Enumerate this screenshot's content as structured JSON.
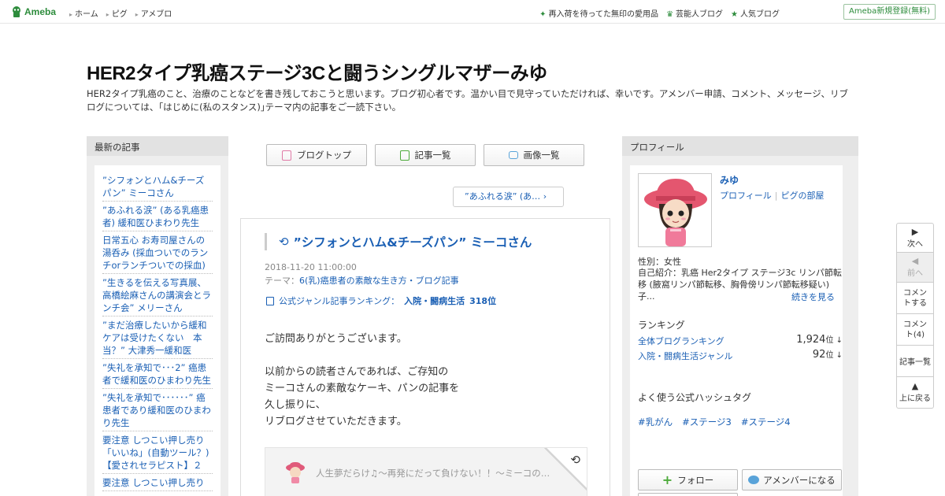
{
  "topbar": {
    "logo_text": "Ameba",
    "nav": [
      "ホーム",
      "ピグ",
      "アメブロ"
    ],
    "links": [
      {
        "icon": "sparkle-icon",
        "label": "再入荷を待ってた無印の愛用品"
      },
      {
        "icon": "crown-icon",
        "label": "芸能人ブログ"
      },
      {
        "icon": "star-icon",
        "label": "人気ブログ"
      }
    ],
    "register_label": "Ameba新規登録(無料)"
  },
  "blog": {
    "title": "HER2タイプ乳癌ステージ3Cと闘うシングルマザーみゆ",
    "description": "HER2タイプ乳癌のこと、治療のことなどを書き残しておこうと思います。ブログ初心者です。温かい目で見守っていただければ、幸いです。アメンバー申請、コメント、メッセージ、リブログについては、｢はじめに(私のスタンス)｣テーマ内の記事をご一読下さい。"
  },
  "left_sidebar": {
    "heading": "最新の記事",
    "items": [
      "”シフォンとハム&チーズパン” ミーコさん",
      "”あふれる涙” (ある乳癌患者) 緩和医ひまわり先生",
      "日常五心 お寿司屋さんの湯呑み (採血ついでのランチorランチついでの採血)",
      "”生きるを伝える写真展、高橋絵麻さんの講演会とランチ会” メリーさん",
      "”まだ治療したいから緩和ケアは受けたくない　本当？” 大津秀一緩和医",
      "”失礼を承知で･･･2” 癌患者で緩和医のひまわり先生",
      "”失礼を承知で･･････” 癌患者であり緩和医のひまわり先生",
      "要注意 しつこい押し売り「いいね」(自動ツール？)【愛されセラピスト】２",
      "要注意 しつこい押し売り"
    ]
  },
  "center": {
    "nav_buttons": [
      "ブログトップ",
      "記事一覧",
      "画像一覧"
    ],
    "prev_entry_label": "”あふれる涙” (あ…",
    "article": {
      "title": "”シフォンとハム&チーズパン” ミーコさん",
      "date": "2018-11-20 11:00:00",
      "theme_prefix": "テーマ：",
      "theme": "6(乳)癌患者の素敵な生き方・ブログ記事",
      "rank_prefix": "公式ジャンル記事ランキング：",
      "rank_category": "入院・闘病生活",
      "rank_value": "318位",
      "body": [
        "ご訪問ありがとうございます。",
        "以前からの読者さんであれば、ご存知の\nミーコさんの素敵なケーキ、パンの記事を\n久し振りに、\nリブログさせていただきます。"
      ],
      "reblog_text": "人生夢だらけ♫〜再発にだって負けない！！〜ミーコの…"
    }
  },
  "right_sidebar": {
    "heading": "プロフィール",
    "name": "みゆ",
    "links": [
      "プロフィール",
      "ピグの部屋"
    ],
    "gender": "性別：女性",
    "intro": "自己紹介：乳癌 Her2タイプ ステージ3c リンパ節転移 (腋窩リンパ節転移、胸骨傍リンパ節転移疑い) 子...",
    "more_label": "続きを見る",
    "ranking_heading": "ランキング",
    "rankings": [
      {
        "label": "全体ブログランキング",
        "value": "1,924",
        "unit": "位 ↓"
      },
      {
        "label": "入院・闘病生活ジャンル",
        "value": "92",
        "unit": "位 ↓"
      }
    ],
    "hashtag_heading": "よく使う公式ハッシュタグ",
    "hashtags": [
      "#乳がん",
      "#ステージ3",
      "#ステージ4"
    ],
    "follow_label": "フォロー",
    "amember_label": "アメンバーになる"
  },
  "float_nav": {
    "next": "次へ",
    "prev": "前へ",
    "comment": "コメントする",
    "comment_count": "コメント(4)",
    "list": "記事一覧",
    "top": "上に戻る"
  },
  "colors": {
    "accent_green": "#2d8c3c",
    "link_blue": "#1a5fb4",
    "sidebar_bg": "#eeeeee"
  }
}
